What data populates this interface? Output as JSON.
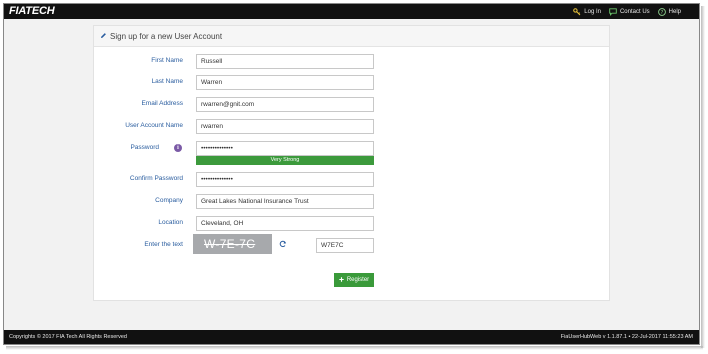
{
  "header": {
    "logo": "FIATECH",
    "nav": [
      {
        "label": "Log In",
        "icon": "key-icon"
      },
      {
        "label": "Contact Us",
        "icon": "chat-icon"
      },
      {
        "label": "Help",
        "icon": "help-icon"
      }
    ]
  },
  "panel": {
    "title": "Sign up for a new User Account",
    "icon": "pencil-icon"
  },
  "form": {
    "first_name": {
      "label": "First Name",
      "value": "Russell"
    },
    "last_name": {
      "label": "Last Name",
      "value": "Warren"
    },
    "email": {
      "label": "Email Address",
      "value": "rwarren@gnit.com"
    },
    "username": {
      "label": "User Account Name",
      "value": "rwarren"
    },
    "password": {
      "label": "Password",
      "value": "••••••••••••••",
      "strength": "Very Strong",
      "info_icon": "info-icon"
    },
    "confirm_password": {
      "label": "Confirm Password",
      "value": "••••••••••••••"
    },
    "company": {
      "label": "Company",
      "value": "Great Lakes National Insurance Trust"
    },
    "location": {
      "label": "Location",
      "value": "Cleveland, OH"
    },
    "captcha": {
      "label": "Enter the text",
      "image_text": "W-7E-7C",
      "value": "W7E7C",
      "refresh_icon": "refresh-icon"
    },
    "register_label": "Register"
  },
  "footer": {
    "copyright": "Copyrights © 2017 FIA Tech All Rights Reserved",
    "version": "FiaUserHubWeb v 1.1.87.1 • 22-Jul-2017 11:55:23 AM"
  },
  "colors": {
    "topbar": "#111111",
    "label": "#2a5d9f",
    "success": "#3c9a3c",
    "info": "#7b5aa6"
  }
}
